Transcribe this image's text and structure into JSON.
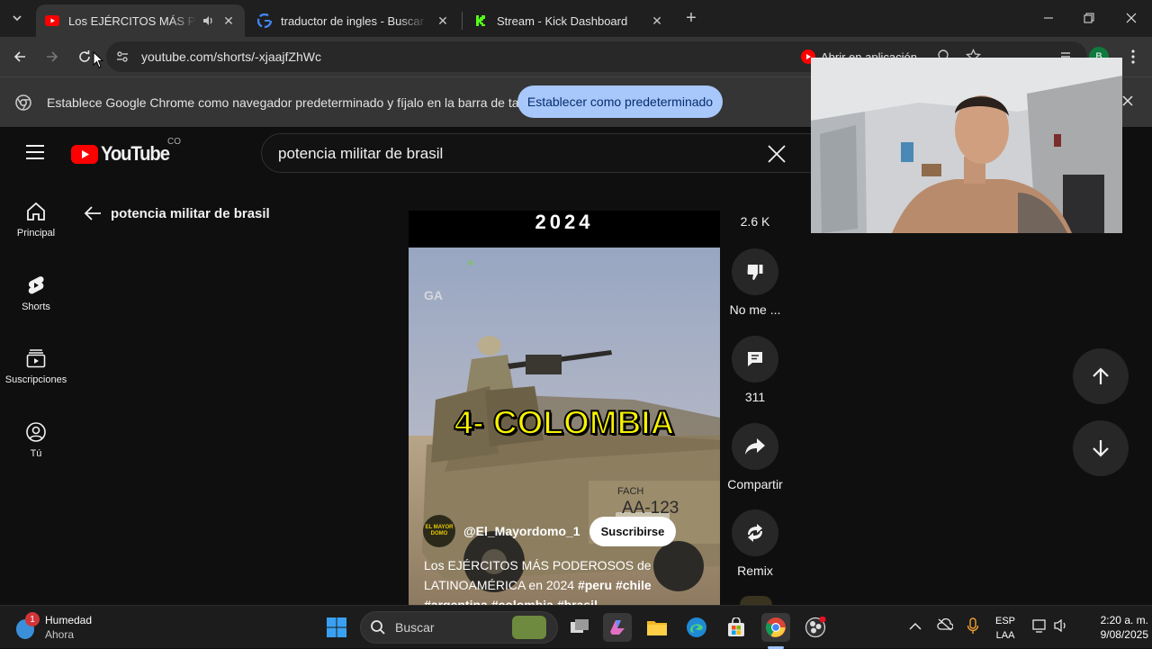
{
  "browser": {
    "tabs": [
      {
        "title": "Los EJÉRCITOS MÁS PODEROSOS",
        "active": true
      },
      {
        "title": "traductor de ingles - Buscar con Google",
        "active": false
      },
      {
        "title": "Stream - Kick Dashboard",
        "active": false
      }
    ],
    "url": "youtube.com/shorts/-xjaajfZhWc",
    "open_in_app": "Abrir en aplicación",
    "profile_initial": "B",
    "infobar": {
      "message": "Establece Google Chrome como navegador predeterminado y fíjalo en la barra de tareas",
      "button": "Establecer como predeterminado"
    }
  },
  "youtube": {
    "logo_text": "YouTube",
    "country": "CO",
    "search_query": "potencia militar de brasil",
    "back_label": "potencia militar de brasil",
    "guide": [
      {
        "label": "Principal",
        "icon": "home-icon"
      },
      {
        "label": "Shorts",
        "icon": "shorts-icon"
      },
      {
        "label": "Suscripciones",
        "icon": "subscriptions-icon"
      },
      {
        "label": "Tú",
        "icon": "you-icon"
      }
    ],
    "short": {
      "top_text": "2024",
      "overlay_text": "4- COLOMBIA",
      "plate_top": "FACH",
      "plate": "AA-123",
      "watermark": "GA",
      "channel": "@El_Mayordomo_1",
      "avatar_text": "EL MAYOR DOMO",
      "subscribe": "Suscribirse",
      "title_plain_1": "Los EJÉRCITOS MÁS PODEROSOS de",
      "title_plain_2": "LATINOAMÉRICA en 2024",
      "hashtags_line2": "#peru #chile",
      "hashtags_line3": "#argentina #colombia #brasil"
    },
    "actions": {
      "likes": "2.6 K",
      "dislike": "No me ...",
      "comments": "311",
      "share": "Compartir",
      "remix": "Remix"
    }
  },
  "taskbar": {
    "weather_title": "Humedad",
    "weather_sub": "Ahora",
    "weather_badge": "1",
    "search_placeholder": "Buscar",
    "lang_top": "ESP",
    "lang_bottom": "LAA",
    "time": "2:20 a. m.",
    "date": "9/08/2025"
  }
}
